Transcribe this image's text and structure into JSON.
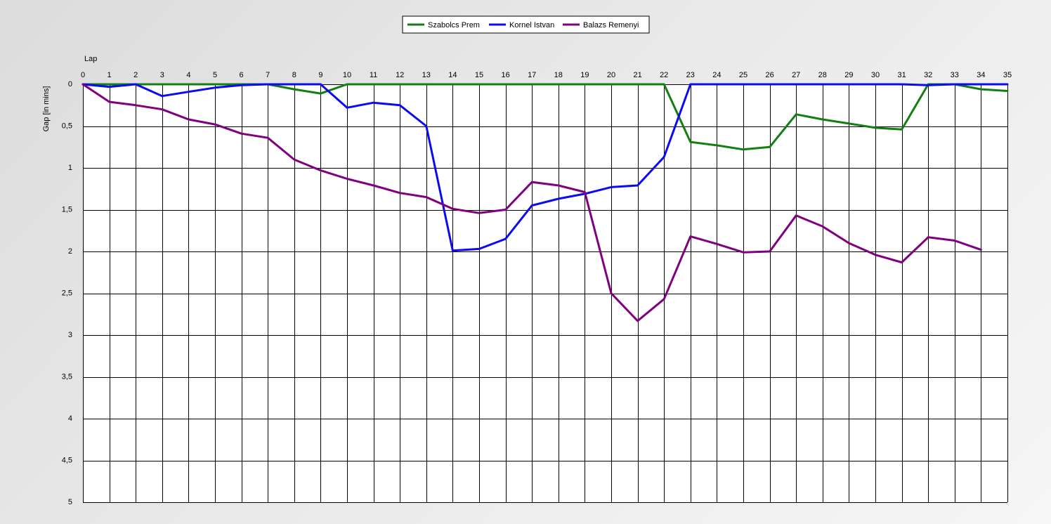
{
  "chart_data": {
    "type": "line",
    "xlabel": "Lap",
    "ylabel": "Gap [in mins]",
    "xlim": [
      0,
      35
    ],
    "ylim": [
      0,
      5
    ],
    "y_axis_inverted": true,
    "x_ticks": [
      "0",
      "1",
      "2",
      "3",
      "4",
      "5",
      "6",
      "7",
      "8",
      "9",
      "10",
      "11",
      "12",
      "13",
      "14",
      "15",
      "16",
      "17",
      "18",
      "19",
      "20",
      "21",
      "22",
      "23",
      "24",
      "25",
      "26",
      "27",
      "28",
      "29",
      "30",
      "31",
      "32",
      "33",
      "34",
      "35"
    ],
    "y_ticks": [
      {
        "value": 0,
        "label": "0"
      },
      {
        "value": 0.5,
        "label": "0,5"
      },
      {
        "value": 1,
        "label": "1"
      },
      {
        "value": 1.5,
        "label": "1,5"
      },
      {
        "value": 2,
        "label": "2"
      },
      {
        "value": 2.5,
        "label": "2,5"
      },
      {
        "value": 3,
        "label": "3"
      },
      {
        "value": 3.5,
        "label": "3,5"
      },
      {
        "value": 4,
        "label": "4"
      },
      {
        "value": 4.5,
        "label": "4,5"
      },
      {
        "value": 5,
        "label": "5"
      }
    ],
    "grid": true,
    "legend_position": "top-center",
    "series": [
      {
        "name": "Szabolcs Prem",
        "color": "#118011",
        "x": [
          0,
          1,
          2,
          3,
          4,
          5,
          6,
          7,
          8,
          9,
          10,
          11,
          12,
          13,
          14,
          15,
          16,
          17,
          18,
          19,
          20,
          21,
          22,
          23,
          24,
          25,
          26,
          27,
          28,
          29,
          30,
          31,
          32,
          33,
          34,
          35
        ],
        "values": [
          0,
          0,
          0,
          0,
          0,
          0,
          0,
          0,
          0.06,
          0.11,
          0,
          0,
          0,
          0,
          0,
          0,
          0,
          0,
          0,
          0,
          0,
          0,
          0,
          0.69,
          0.73,
          0.78,
          0.75,
          0.36,
          0.42,
          0.47,
          0.52,
          0.54,
          0,
          0,
          0.06,
          0.08
        ]
      },
      {
        "name": "Kornel Istvan",
        "color": "#0b0bf2",
        "x": [
          0,
          1,
          2,
          3,
          4,
          5,
          6,
          7,
          8,
          9,
          10,
          11,
          12,
          13,
          14,
          15,
          16,
          17,
          18,
          19,
          20,
          21,
          22,
          23,
          24,
          25,
          26,
          27,
          28,
          29,
          30,
          31,
          32,
          33,
          34,
          35
        ],
        "values": [
          0,
          0.03,
          0,
          0.14,
          0.09,
          0.04,
          0.01,
          0,
          0,
          0,
          0.28,
          0.22,
          0.25,
          0.5,
          1.99,
          1.97,
          1.85,
          1.45,
          1.37,
          1.31,
          1.23,
          1.21,
          0.87,
          0,
          0,
          0,
          0,
          0,
          0,
          0,
          0,
          0,
          0.01,
          0,
          0,
          0
        ]
      },
      {
        "name": "Balazs Remenyi",
        "color": "#800080",
        "x": [
          0,
          1,
          2,
          3,
          4,
          5,
          6,
          7,
          8,
          9,
          10,
          11,
          12,
          13,
          14,
          15,
          16,
          17,
          18,
          19,
          20,
          21,
          22,
          23,
          24,
          25,
          26,
          27,
          28,
          29,
          30,
          31,
          32,
          33,
          34
        ],
        "values": [
          0,
          0.21,
          0.25,
          0.3,
          0.42,
          0.48,
          0.59,
          0.64,
          0.9,
          1.03,
          1.13,
          1.21,
          1.3,
          1.35,
          1.49,
          1.54,
          1.5,
          1.17,
          1.21,
          1.29,
          2.5,
          2.83,
          2.57,
          1.82,
          1.91,
          2.01,
          2.0,
          1.57,
          1.7,
          1.9,
          2.04,
          2.13,
          1.83,
          1.87,
          1.98
        ]
      }
    ]
  }
}
